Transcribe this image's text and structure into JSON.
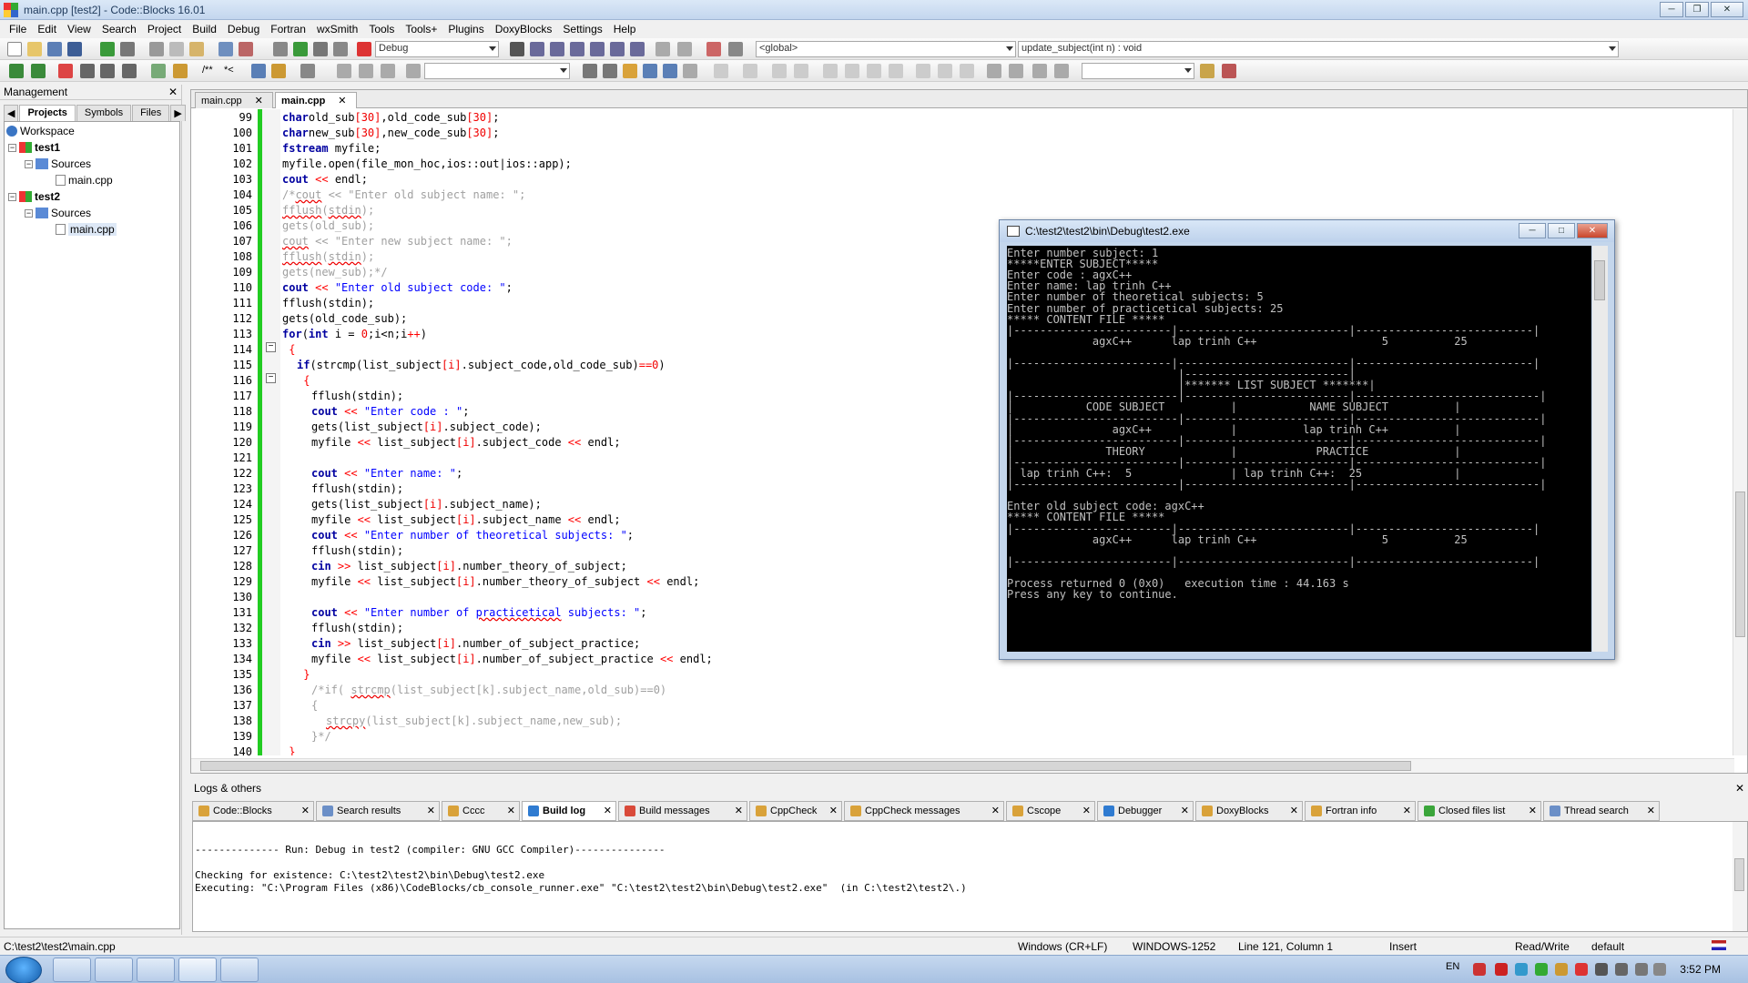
{
  "window": {
    "title": "main.cpp [test2] - Code::Blocks 16.01"
  },
  "menu": [
    "File",
    "Edit",
    "View",
    "Search",
    "Project",
    "Build",
    "Debug",
    "Fortran",
    "wxSmith",
    "Tools",
    "Tools+",
    "Plugins",
    "DoxyBlocks",
    "Settings",
    "Help"
  ],
  "toolbar": {
    "build_target": "Debug",
    "scope": "<global>",
    "function": "update_subject(int n) : void",
    "comment_labels": [
      "/**",
      "*<"
    ]
  },
  "management": {
    "title": "Management",
    "tabs": [
      "Projects",
      "Symbols",
      "Files"
    ],
    "tree": [
      {
        "label": "Workspace",
        "level": 0
      },
      {
        "label": "test1",
        "level": 1,
        "bold": true
      },
      {
        "label": "Sources",
        "level": 2
      },
      {
        "label": "main.cpp",
        "level": 3
      },
      {
        "label": "test2",
        "level": 1,
        "bold": true
      },
      {
        "label": "Sources",
        "level": 2
      },
      {
        "label": "main.cpp",
        "level": 3,
        "selected": true
      }
    ]
  },
  "editor": {
    "tabs": [
      {
        "label": "main.cpp",
        "active": false
      },
      {
        "label": "main.cpp",
        "active": true
      }
    ],
    "lines": [
      {
        "n": "99",
        "indent": 0,
        "tokens": [
          [
            "kw",
            "char"
          ],
          [
            "",
            "old_sub"
          ],
          [
            "num",
            "[30]"
          ],
          [
            "",
            ",old_code_sub"
          ],
          [
            "num",
            "[30]"
          ],
          [
            "",
            ";"
          ]
        ]
      },
      {
        "n": "100",
        "indent": 0,
        "tokens": [
          [
            "kw",
            "char"
          ],
          [
            "",
            "new_sub"
          ],
          [
            "num",
            "[30]"
          ],
          [
            "",
            ",new_code_sub"
          ],
          [
            "num",
            "[30]"
          ],
          [
            "",
            ";"
          ]
        ]
      },
      {
        "n": "101",
        "indent": 0,
        "tokens": [
          [
            "kw",
            "fstream"
          ],
          [
            "",
            " myfile;"
          ]
        ]
      },
      {
        "n": "102",
        "indent": 0,
        "tokens": [
          [
            "",
            "myfile.open(file_mon_hoc,ios::out|ios::app);"
          ]
        ]
      },
      {
        "n": "103",
        "indent": 0,
        "tokens": [
          [
            "kw",
            "cout"
          ],
          [
            "op",
            " << "
          ],
          [
            "",
            "endl;"
          ]
        ]
      },
      {
        "n": "104",
        "indent": 0,
        "tokens": [
          [
            "cmt",
            "/*"
          ],
          [
            "cmt squig",
            "cout"
          ],
          [
            "cmt",
            " << \"Enter old subject name: \";"
          ]
        ]
      },
      {
        "n": "105",
        "indent": 0,
        "tokens": [
          [
            "cmt squig",
            "fflush"
          ],
          [
            "cmt",
            "("
          ],
          [
            "cmt squig",
            "stdin"
          ],
          [
            "cmt",
            ");"
          ]
        ]
      },
      {
        "n": "106",
        "indent": 0,
        "tokens": [
          [
            "cmt",
            "gets(old_sub);"
          ]
        ]
      },
      {
        "n": "107",
        "indent": 0,
        "tokens": [
          [
            "cmt squig",
            "cout"
          ],
          [
            "cmt",
            " << \"Enter new subject name: \";"
          ]
        ]
      },
      {
        "n": "108",
        "indent": 0,
        "tokens": [
          [
            "cmt squig",
            "fflush"
          ],
          [
            "cmt",
            "("
          ],
          [
            "cmt squig",
            "stdin"
          ],
          [
            "cmt",
            ");"
          ]
        ]
      },
      {
        "n": "109",
        "indent": 0,
        "tokens": [
          [
            "cmt",
            "gets(new_sub);*/"
          ]
        ]
      },
      {
        "n": "110",
        "indent": 0,
        "tokens": [
          [
            "kw",
            "cout"
          ],
          [
            "op",
            " << "
          ],
          [
            "str",
            "\"Enter old subject code: \""
          ],
          [
            "",
            ";"
          ]
        ]
      },
      {
        "n": "111",
        "indent": 0,
        "tokens": [
          [
            "",
            "fflush(stdin);"
          ]
        ]
      },
      {
        "n": "112",
        "indent": 0,
        "tokens": [
          [
            "",
            "gets(old_code_sub);"
          ]
        ]
      },
      {
        "n": "113",
        "indent": 0,
        "tokens": [
          [
            "kw",
            "for"
          ],
          [
            "",
            "("
          ],
          [
            "kw",
            "int"
          ],
          [
            "",
            " i = "
          ],
          [
            "num",
            "0"
          ],
          [
            "",
            ";i<n;i"
          ],
          [
            "op",
            "++"
          ],
          [
            "",
            ")"
          ]
        ]
      },
      {
        "n": "114",
        "indent": 0,
        "tokens": [
          [
            "op",
            " {"
          ]
        ]
      },
      {
        "n": "115",
        "indent": 1,
        "tokens": [
          [
            "kw",
            "if"
          ],
          [
            "",
            "(strcmp(list_subject"
          ],
          [
            "num",
            "[i]"
          ],
          [
            "",
            ".subject_code,old_code_sub)"
          ],
          [
            "op",
            "=="
          ],
          [
            "num",
            "0"
          ],
          [
            "",
            ")"
          ]
        ]
      },
      {
        "n": "116",
        "indent": 1,
        "tokens": [
          [
            "op",
            " {"
          ]
        ]
      },
      {
        "n": "117",
        "indent": 2,
        "tokens": [
          [
            "",
            "fflush(stdin);"
          ]
        ]
      },
      {
        "n": "118",
        "indent": 2,
        "tokens": [
          [
            "kw",
            "cout"
          ],
          [
            "op",
            " << "
          ],
          [
            "str",
            "\"Enter code : \""
          ],
          [
            "",
            ";"
          ]
        ]
      },
      {
        "n": "119",
        "indent": 2,
        "tokens": [
          [
            "",
            "gets(list_subject"
          ],
          [
            "num",
            "[i]"
          ],
          [
            "",
            ".subject_code);"
          ]
        ]
      },
      {
        "n": "120",
        "indent": 2,
        "tokens": [
          [
            "",
            "myfile"
          ],
          [
            "op",
            " << "
          ],
          [
            "",
            "list_subject"
          ],
          [
            "num",
            "[i]"
          ],
          [
            "",
            ".subject_code"
          ],
          [
            "op",
            " << "
          ],
          [
            "",
            "endl;"
          ]
        ]
      },
      {
        "n": "121",
        "indent": 2,
        "tokens": []
      },
      {
        "n": "122",
        "indent": 2,
        "tokens": [
          [
            "kw",
            "cout"
          ],
          [
            "op",
            " << "
          ],
          [
            "str",
            "\"Enter name: \""
          ],
          [
            "",
            ";"
          ]
        ]
      },
      {
        "n": "123",
        "indent": 2,
        "tokens": [
          [
            "",
            "fflush(stdin);"
          ]
        ]
      },
      {
        "n": "124",
        "indent": 2,
        "tokens": [
          [
            "",
            "gets(list_subject"
          ],
          [
            "num",
            "[i]"
          ],
          [
            "",
            ".subject_name);"
          ]
        ]
      },
      {
        "n": "125",
        "indent": 2,
        "tokens": [
          [
            "",
            "myfile"
          ],
          [
            "op",
            " << "
          ],
          [
            "",
            "list_subject"
          ],
          [
            "num",
            "[i]"
          ],
          [
            "",
            ".subject_name"
          ],
          [
            "op",
            " << "
          ],
          [
            "",
            "endl;"
          ]
        ]
      },
      {
        "n": "126",
        "indent": 2,
        "tokens": [
          [
            "kw",
            "cout"
          ],
          [
            "op",
            " << "
          ],
          [
            "str",
            "\"Enter number of theoretical subjects: \""
          ],
          [
            "",
            ";"
          ]
        ]
      },
      {
        "n": "127",
        "indent": 2,
        "tokens": [
          [
            "",
            "fflush(stdin);"
          ]
        ]
      },
      {
        "n": "128",
        "indent": 2,
        "tokens": [
          [
            "kw",
            "cin"
          ],
          [
            "op",
            " >> "
          ],
          [
            "",
            "list_subject"
          ],
          [
            "num",
            "[i]"
          ],
          [
            "",
            ".number_theory_of_subject;"
          ]
        ]
      },
      {
        "n": "129",
        "indent": 2,
        "tokens": [
          [
            "",
            "myfile"
          ],
          [
            "op",
            " << "
          ],
          [
            "",
            "list_subject"
          ],
          [
            "num",
            "[i]"
          ],
          [
            "",
            ".number_theory_of_subject"
          ],
          [
            "op",
            " << "
          ],
          [
            "",
            "endl;"
          ]
        ]
      },
      {
        "n": "130",
        "indent": 2,
        "tokens": []
      },
      {
        "n": "131",
        "indent": 2,
        "tokens": [
          [
            "kw",
            "cout"
          ],
          [
            "op",
            " << "
          ],
          [
            "str",
            "\"Enter number of "
          ],
          [
            "str squig",
            "practicetical"
          ],
          [
            "str",
            " subjects: \""
          ],
          [
            "",
            ";"
          ]
        ]
      },
      {
        "n": "132",
        "indent": 2,
        "tokens": [
          [
            "",
            "fflush(stdin);"
          ]
        ]
      },
      {
        "n": "133",
        "indent": 2,
        "tokens": [
          [
            "kw",
            "cin"
          ],
          [
            "op",
            " >> "
          ],
          [
            "",
            "list_subject"
          ],
          [
            "num",
            "[i]"
          ],
          [
            "",
            ".number_of_subject_practice;"
          ]
        ]
      },
      {
        "n": "134",
        "indent": 2,
        "tokens": [
          [
            "",
            "myfile"
          ],
          [
            "op",
            " << "
          ],
          [
            "",
            "list_subject"
          ],
          [
            "num",
            "[i]"
          ],
          [
            "",
            ".number_of_subject_practice"
          ],
          [
            "op",
            " << "
          ],
          [
            "",
            "endl;"
          ]
        ]
      },
      {
        "n": "135",
        "indent": 1,
        "tokens": [
          [
            "op",
            " }"
          ]
        ]
      },
      {
        "n": "136",
        "indent": 2,
        "tokens": [
          [
            "cmt",
            "/*if( "
          ],
          [
            "cmt squig",
            "strcmp"
          ],
          [
            "cmt",
            "(list_subject[k].subject_name,old_sub)==0)"
          ]
        ]
      },
      {
        "n": "137",
        "indent": 2,
        "tokens": [
          [
            "cmt",
            "{"
          ]
        ]
      },
      {
        "n": "138",
        "indent": 3,
        "tokens": [
          [
            "cmt squig",
            "strcpy"
          ],
          [
            "cmt",
            "(list_subject[k].subject_name,new_sub);"
          ]
        ]
      },
      {
        "n": "139",
        "indent": 2,
        "tokens": [
          [
            "cmt",
            "}*/"
          ]
        ]
      },
      {
        "n": "140",
        "indent": 0,
        "tokens": [
          [
            "op",
            " }"
          ]
        ]
      }
    ]
  },
  "console": {
    "title": "C:\\test2\\test2\\bin\\Debug\\test2.exe",
    "lines": [
      "Enter number subject: 1",
      "*****ENTER SUBJECT*****",
      "Enter code : agxC++",
      "Enter name: lap trinh C++",
      "Enter number of theoretical subjects: 5",
      "Enter number of practicetical subjects: 25",
      "***** CONTENT FILE *****",
      "|------------------------|--------------------------|---------------------------|",
      "             agxC++      lap trinh C++                   5          25",
      "",
      "|------------------------|--------------------------|---------------------------|",
      "                          |-------------------------|",
      "                          |******* LIST SUBJECT *******|",
      "|-------------------------|-------------------------|----------------------------|",
      "|           CODE SUBJECT          |           NAME SUBJECT          |",
      "|-------------------------|-------------------------|----------------------------|",
      "|               agxC++            |          lap trinh C++          |",
      "|-------------------------|-------------------------|----------------------------|",
      "|              THEORY             |            PRACTICE             |",
      "|-------------------------|-------------------------|----------------------------|",
      "| lap trinh C++:  5               | lap trinh C++:  25              |",
      "|-------------------------|-------------------------|----------------------------|",
      "",
      "Enter old subject code: agxC++",
      "***** CONTENT FILE *****",
      "|------------------------|--------------------------|---------------------------|",
      "             agxC++      lap trinh C++                   5          25",
      "",
      "|------------------------|--------------------------|---------------------------|",
      "",
      "Process returned 0 (0x0)   execution time : 44.163 s",
      "Press any key to continue."
    ]
  },
  "logs": {
    "title": "Logs & others",
    "tabs": [
      {
        "label": "Code::Blocks",
        "color": "#d9a23a"
      },
      {
        "label": "Search results",
        "color": "#6b8fc7"
      },
      {
        "label": "Cccc",
        "color": "#d9a23a"
      },
      {
        "label": "Build log",
        "color": "#2f7bd1",
        "active": true
      },
      {
        "label": "Build messages",
        "color": "#d94a3a"
      },
      {
        "label": "CppCheck",
        "color": "#d9a23a"
      },
      {
        "label": "CppCheck messages",
        "color": "#d9a23a"
      },
      {
        "label": "Cscope",
        "color": "#d9a23a"
      },
      {
        "label": "Debugger",
        "color": "#2f7bd1"
      },
      {
        "label": "DoxyBlocks",
        "color": "#d9a23a"
      },
      {
        "label": "Fortran info",
        "color": "#d9a23a"
      },
      {
        "label": "Closed files list",
        "color": "#3aa53a"
      },
      {
        "label": "Thread search",
        "color": "#6b8fc7"
      }
    ],
    "lines": [
      "",
      "-------------- Run: Debug in test2 (compiler: GNU GCC Compiler)---------------",
      "",
      "Checking for existence: C:\\test2\\test2\\bin\\Debug\\test2.exe",
      "Executing: \"C:\\Program Files (x86)\\CodeBlocks/cb_console_runner.exe\" \"C:\\test2\\test2\\bin\\Debug\\test2.exe\"  (in C:\\test2\\test2\\.)"
    ]
  },
  "status": {
    "path": "C:\\test2\\test2\\main.cpp",
    "eol": "Windows (CR+LF)",
    "encoding": "WINDOWS-1252",
    "position": "Line 121, Column 1",
    "mode": "Insert",
    "access": "Read/Write",
    "config": "default"
  },
  "taskbar": {
    "lang": "EN",
    "clock": "3:52 PM"
  },
  "colors": {
    "keyword": "#0000a0",
    "string": "#0000ff",
    "number": "#f00000",
    "comment": "#a0a0a0",
    "changebar": "#22cc22"
  }
}
